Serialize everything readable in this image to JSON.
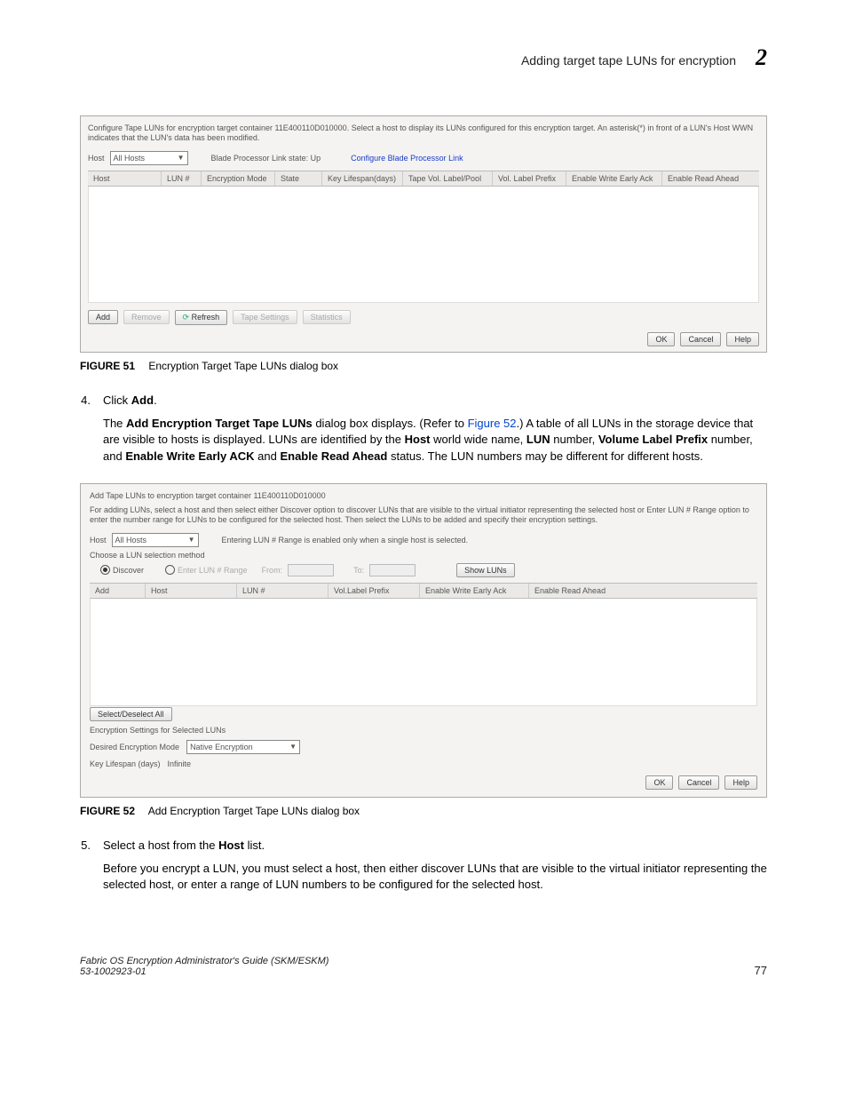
{
  "header": {
    "title": "Adding target tape LUNs for encryption",
    "chapter": "2"
  },
  "fig51": {
    "caption_label": "FIGURE 51",
    "caption_text": "Encryption Target Tape LUNs dialog box",
    "desc": "Configure Tape LUNs for encryption target container 11E400110D010000. Select a host to display its LUNs configured for this encryption target. An asterisk(*) in front of a LUN's Host WWN indicates that the LUN's data has been modified.",
    "host_label": "Host",
    "host_value": "All Hosts",
    "blade_label": "Blade Processor Link state: Up",
    "blade_link": "Configure Blade Processor Link",
    "cols": [
      "Host",
      "LUN #",
      "Encryption Mode",
      "State",
      "Key Lifespan(days)",
      "Tape Vol. Label/Pool",
      "Vol. Label Prefix",
      "Enable Write Early Ack",
      "Enable Read Ahead"
    ],
    "btn_add": "Add",
    "btn_remove": "Remove",
    "btn_refresh": "Refresh",
    "btn_tape": "Tape Settings",
    "btn_stats": "Statistics",
    "btn_ok": "OK",
    "btn_cancel": "Cancel",
    "btn_help": "Help"
  },
  "step4": {
    "num": "4.",
    "text_pre": "Click ",
    "text_bold": "Add",
    "text_post": "."
  },
  "para4": {
    "p1_a": "The ",
    "p1_b": "Add Encryption Target Tape LUNs",
    "p1_c": " dialog box displays. (Refer to ",
    "p1_link": "Figure 52",
    "p1_d": ".) A table of all LUNs in the storage device that are visible to hosts is displayed. LUNs are identified by the ",
    "p1_e": "Host",
    "p1_f": " world wide name, ",
    "p1_g": "LUN",
    "p1_h": " number, ",
    "p1_i": "Volume Label Prefix",
    "p1_j": " number, and ",
    "p1_k": "Enable Write Early ACK",
    "p1_l": " and ",
    "p1_m": "Enable Read Ahead",
    "p1_n": " status. The LUN numbers may be different for different hosts."
  },
  "fig52": {
    "caption_label": "FIGURE 52",
    "caption_text": "Add Encryption Target Tape LUNs dialog box",
    "title": "Add Tape LUNs to encryption target container 11E400110D010000",
    "desc": "For adding LUNs, select a host and then select either Discover option to discover LUNs that are visible to the virtual initiator representing the selected host or Enter LUN # Range option to enter the number range for LUNs to be configured for the selected host. Then select the LUNs to be added and specify their encryption settings.",
    "host_label": "Host",
    "host_value": "All Hosts",
    "host_note": "Entering LUN # Range is enabled only when a single host is selected.",
    "choose_label": "Choose a LUN selection method",
    "discover": "Discover",
    "enter_range": "Enter LUN # Range",
    "from": "From:",
    "to": "To:",
    "show_luns": "Show LUNs",
    "cols": [
      "Add",
      "Host",
      "LUN #",
      "Vol.Label Prefix",
      "Enable Write Early Ack",
      "Enable Read Ahead"
    ],
    "select_all": "Select/Deselect All",
    "settings_head": "Encryption Settings for Selected LUNs",
    "enc_mode_label": "Desired Encryption Mode",
    "enc_mode_value": "Native Encryption",
    "lifespan_label": "Key Lifespan (days)",
    "lifespan_value": "Infinite",
    "btn_ok": "OK",
    "btn_cancel": "Cancel",
    "btn_help": "Help"
  },
  "step5": {
    "num": "5.",
    "text_pre": "Select a host from the ",
    "text_bold": "Host",
    "text_post": " list."
  },
  "para5": "Before you encrypt a LUN, you must select a host, then either discover LUNs that are visible to the virtual initiator representing the selected host, or enter a range of LUN numbers to be configured for the selected host.",
  "footer": {
    "line1": "Fabric OS Encryption Administrator's Guide (SKM/ESKM)",
    "line2": "53-1002923-01",
    "page": "77"
  }
}
